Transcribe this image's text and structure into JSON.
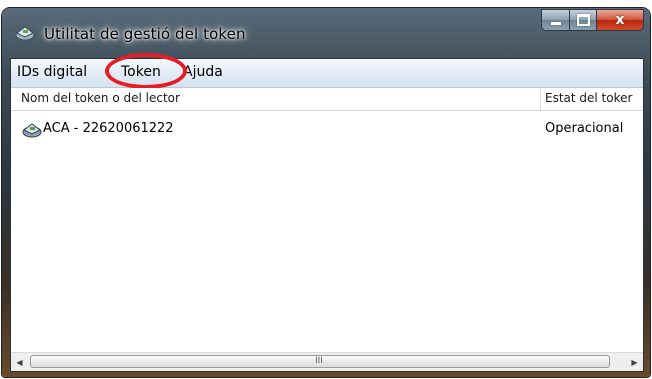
{
  "window": {
    "title": "Utilitat de gestió del token",
    "app_icon": "token-reader-icon",
    "close_glyph": "x"
  },
  "menu": {
    "items": [
      {
        "label": "IDs digital"
      },
      {
        "label": "Token"
      },
      {
        "label": "Ajuda"
      }
    ],
    "highlighted": "Token",
    "highlight_color": "#e51d25"
  },
  "list": {
    "columns": [
      {
        "label": "Nom del token o del lector"
      },
      {
        "label": "Estat del toker"
      }
    ],
    "rows": [
      {
        "icon": "token-reader-icon",
        "name": "ACA - 22620061222",
        "status": "Operacional"
      }
    ]
  },
  "scrollbar": {
    "left_arrow": "◀",
    "right_arrow": "▶",
    "grip": "III"
  }
}
